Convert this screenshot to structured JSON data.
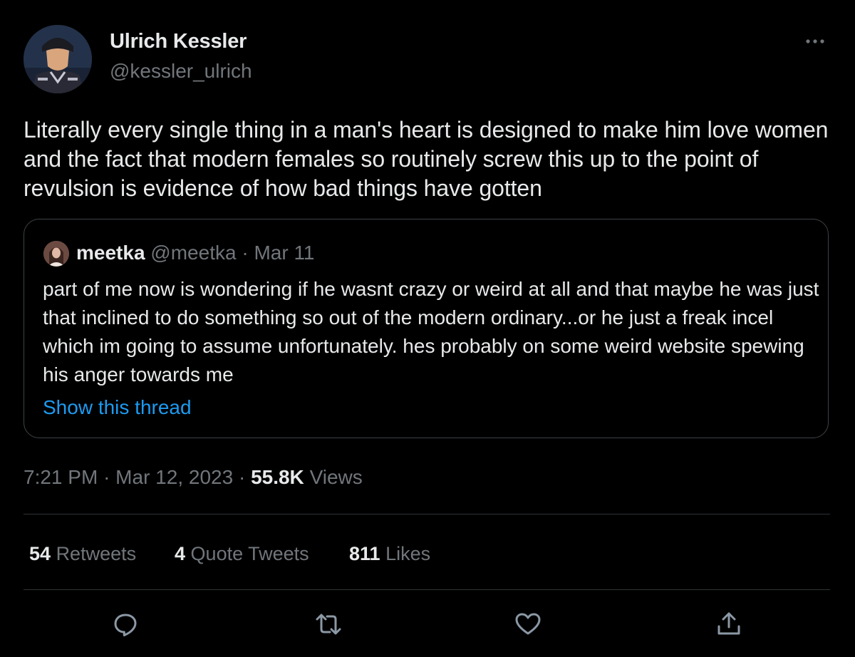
{
  "tweet": {
    "author": {
      "name": "Ulrich Kessler",
      "handle": "@kessler_ulrich"
    },
    "text": "Literally every single thing in a man's heart is designed to make him love women and the fact that modern females so routinely screw this up to the point of revulsion is evidence of how bad things have gotten",
    "time": "7:21 PM",
    "sep1": "·",
    "date": "Mar 12, 2023",
    "sep2": "·",
    "views_count": "55.8K",
    "views_label": "Views"
  },
  "quote": {
    "name": "meetka",
    "handle": "@meetka",
    "sep": "·",
    "date": "Mar 11",
    "text": "part of me now is wondering if he wasnt crazy or weird at all and that maybe he was just that inclined to do something so out of the modern ordinary...or he just a freak incel which im going to assume unfortunately. hes probably on some weird website spewing his anger towards me",
    "show_thread": "Show this thread"
  },
  "stats": {
    "retweets_count": "54",
    "retweets_label": "Retweets",
    "quotes_count": "4",
    "quotes_label": "Quote Tweets",
    "likes_count": "811",
    "likes_label": "Likes"
  },
  "actions": {
    "icons": [
      "reply-icon",
      "retweet-icon",
      "like-icon",
      "share-icon"
    ]
  },
  "colors": {
    "background": "#000000",
    "primary_text": "#e7e9ea",
    "secondary_text": "#71767b",
    "link": "#1d9bf0",
    "border": "#2f3336"
  }
}
